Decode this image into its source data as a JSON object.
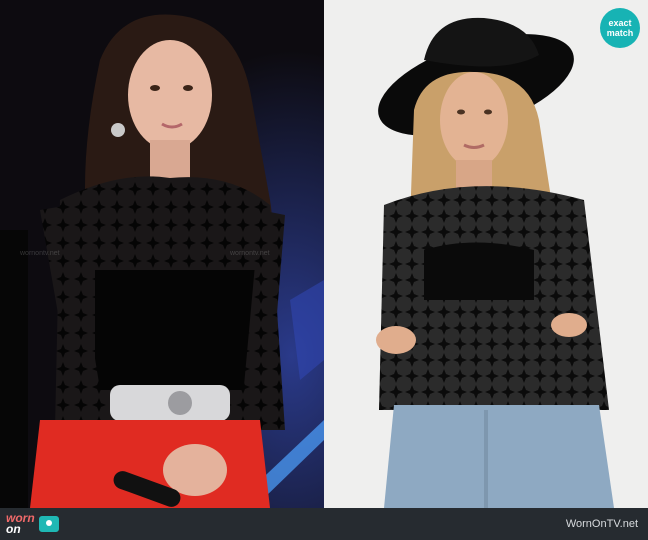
{
  "badge": {
    "line1": "exact",
    "line2": "match"
  },
  "watermark_text": "wornontv.net",
  "footer": {
    "logo_worn": "worn",
    "logo_on": "on",
    "site_url": "WornOnTV.net"
  },
  "colors": {
    "badge": "#17b3b4",
    "footer_bg": "#262b30",
    "logo_worn": "#f06a6a",
    "tv_icon": "#1fb8b4"
  }
}
